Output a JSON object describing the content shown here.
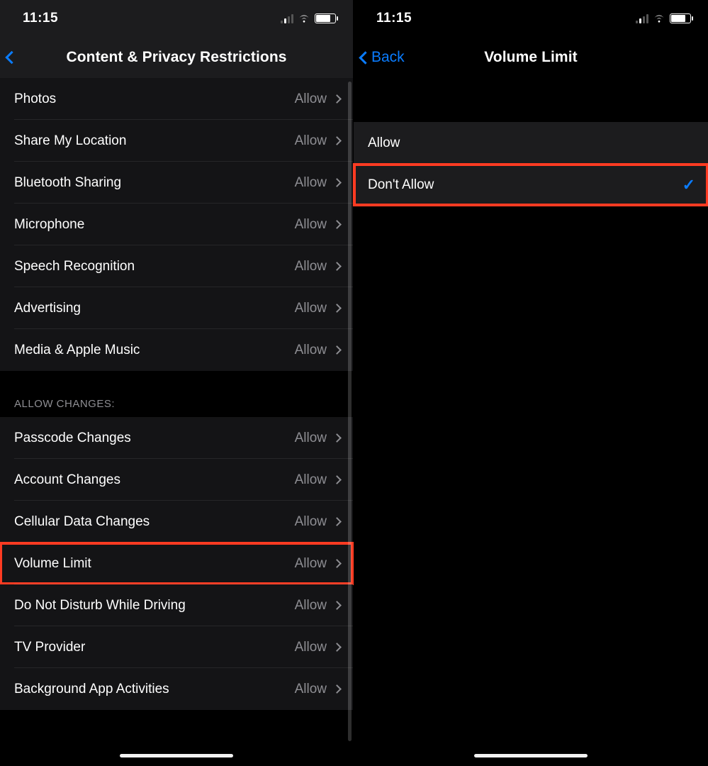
{
  "status": {
    "time": "11:15"
  },
  "left": {
    "title": "Content & Privacy Restrictions",
    "group1": [
      {
        "label": "Photos",
        "value": "Allow"
      },
      {
        "label": "Share My Location",
        "value": "Allow"
      },
      {
        "label": "Bluetooth Sharing",
        "value": "Allow"
      },
      {
        "label": "Microphone",
        "value": "Allow"
      },
      {
        "label": "Speech Recognition",
        "value": "Allow"
      },
      {
        "label": "Advertising",
        "value": "Allow"
      },
      {
        "label": "Media & Apple Music",
        "value": "Allow"
      }
    ],
    "section_header": "ALLOW CHANGES:",
    "group2": [
      {
        "label": "Passcode Changes",
        "value": "Allow"
      },
      {
        "label": "Account Changes",
        "value": "Allow"
      },
      {
        "label": "Cellular Data Changes",
        "value": "Allow"
      },
      {
        "label": "Volume Limit",
        "value": "Allow",
        "highlight": true
      },
      {
        "label": "Do Not Disturb While Driving",
        "value": "Allow"
      },
      {
        "label": "TV Provider",
        "value": "Allow"
      },
      {
        "label": "Background App Activities",
        "value": "Allow"
      }
    ]
  },
  "right": {
    "back_label": "Back",
    "title": "Volume Limit",
    "options": [
      {
        "label": "Allow",
        "selected": false
      },
      {
        "label": "Don't Allow",
        "selected": true,
        "highlight": true
      }
    ]
  }
}
